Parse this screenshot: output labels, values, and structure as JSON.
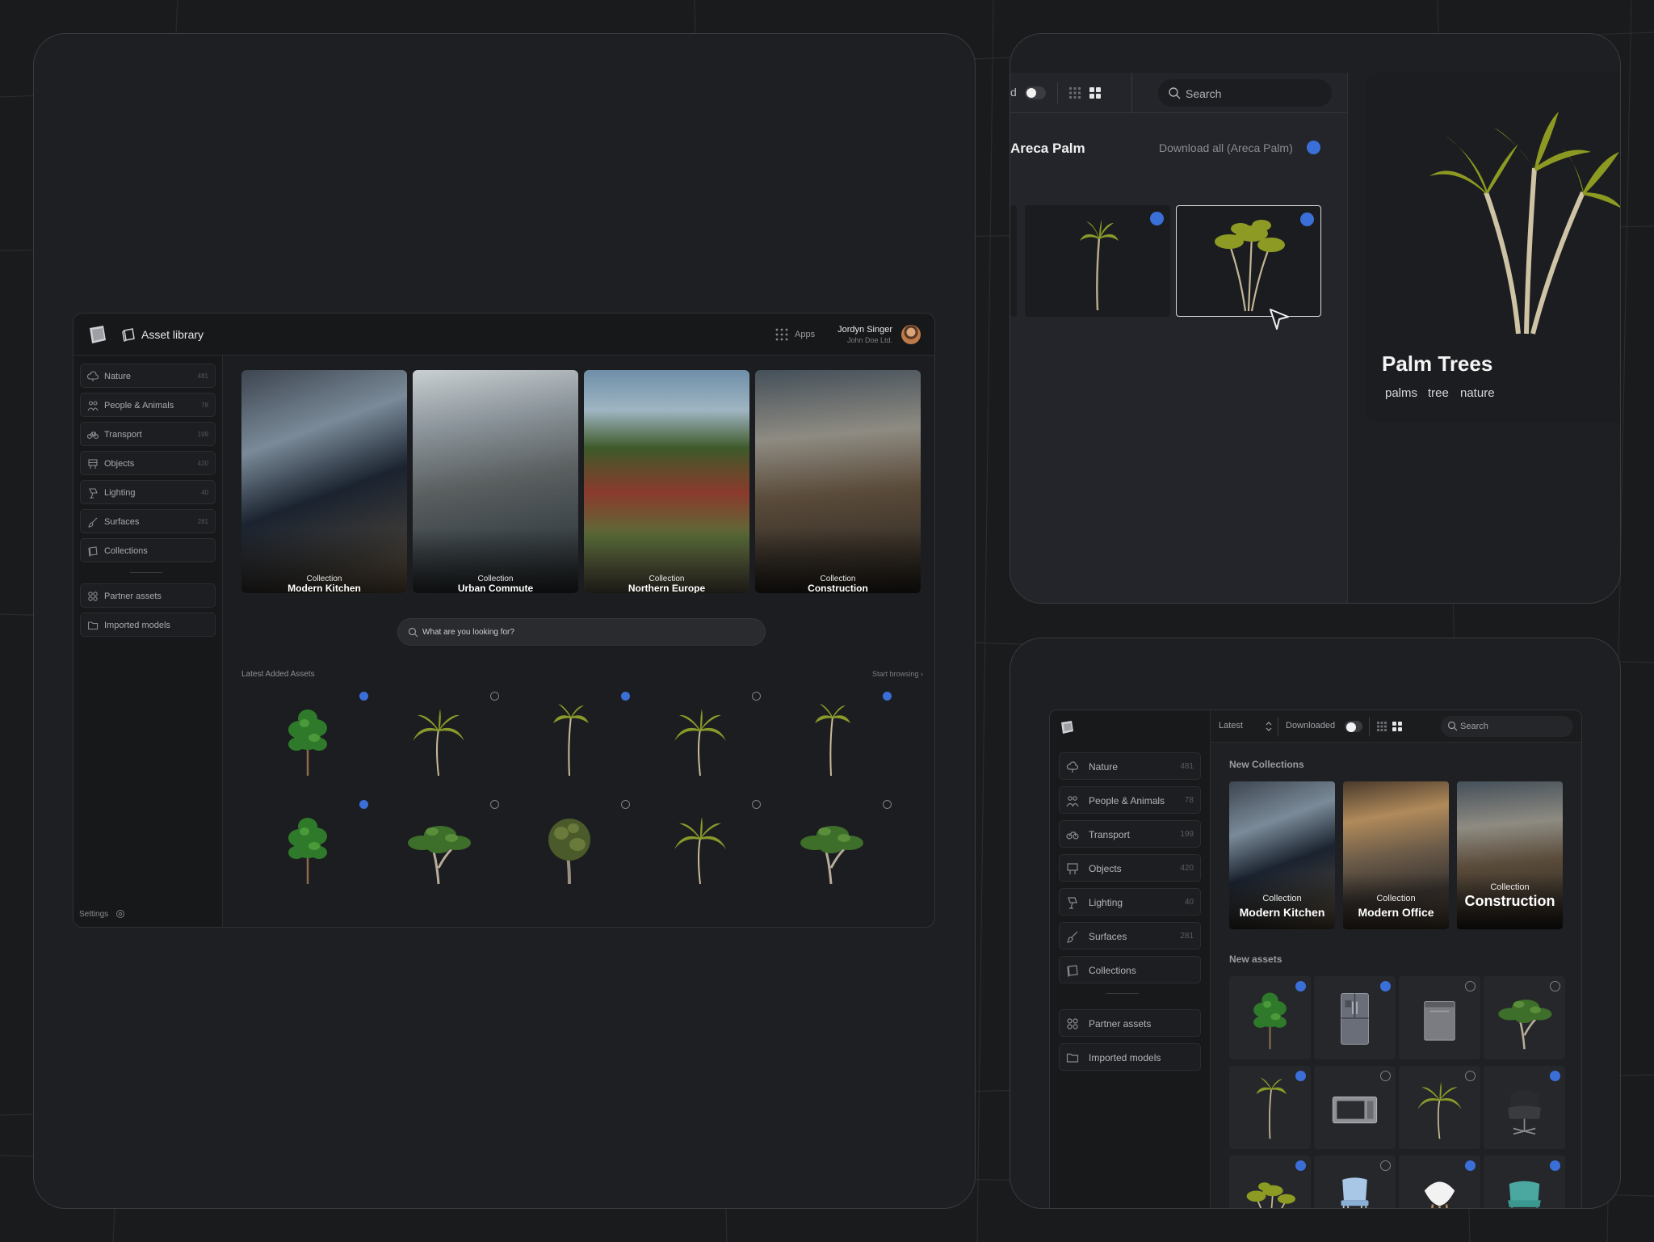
{
  "main_app": {
    "title": "Asset library",
    "apps_label": "Apps",
    "user": {
      "name": "Jordyn Singer",
      "org": "John Doe Ltd."
    },
    "sidebar": [
      {
        "label": "Nature",
        "count": "481",
        "icon": "cloud-icon"
      },
      {
        "label": "People & Animals",
        "count": "78",
        "icon": "people-icon"
      },
      {
        "label": "Transport",
        "count": "199",
        "icon": "bicycle-icon"
      },
      {
        "label": "Objects",
        "count": "420",
        "icon": "object-icon"
      },
      {
        "label": "Lighting",
        "count": "40",
        "icon": "lamp-icon"
      },
      {
        "label": "Surfaces",
        "count": "281",
        "icon": "brush-icon"
      },
      {
        "label": "Collections",
        "count": "",
        "icon": "collection-icon"
      }
    ],
    "sidebar_extra": [
      {
        "label": "Partner assets",
        "icon": "grid-icon"
      },
      {
        "label": "Imported models",
        "icon": "folder-icon"
      }
    ],
    "settings_label": "Settings",
    "collections": [
      {
        "caption": "Collection",
        "name": "Modern Kitchen"
      },
      {
        "caption": "Collection",
        "name": "Urban Commute"
      },
      {
        "caption": "Collection",
        "name": "Northern Europe"
      },
      {
        "caption": "Collection",
        "name": "Construction"
      }
    ],
    "search_placeholder": "What are you looking for?",
    "latest_title": "Latest Added Assets",
    "start_browsing": "Start browsing ›",
    "assets": [
      {
        "kind": "tree",
        "status": "download"
      },
      {
        "kind": "palm",
        "status": "downloaded"
      },
      {
        "kind": "palm-tall",
        "status": "download"
      },
      {
        "kind": "palm",
        "status": "downloaded"
      },
      {
        "kind": "palm-tall",
        "status": "download"
      },
      {
        "kind": "tree",
        "status": "download"
      },
      {
        "kind": "tree-wide",
        "status": "downloaded"
      },
      {
        "kind": "tree-round",
        "status": "downloaded"
      },
      {
        "kind": "palm",
        "status": "downloaded"
      },
      {
        "kind": "tree-wide",
        "status": "downloaded"
      }
    ]
  },
  "detail_view": {
    "toolbar_fragment": "d",
    "search_placeholder": "Search",
    "title": "Areca Palm",
    "download_all": "Download all (Areca Palm)",
    "preview": {
      "title": "Palm Trees",
      "tags": [
        "palms",
        "tree",
        "nature"
      ]
    }
  },
  "compact_app": {
    "sort_label": "Latest",
    "downloaded_label": "Downloaded",
    "search_placeholder": "Search",
    "sidebar": [
      {
        "label": "Nature",
        "count": "481"
      },
      {
        "label": "People & Animals",
        "count": "78"
      },
      {
        "label": "Transport",
        "count": "199"
      },
      {
        "label": "Objects",
        "count": "420"
      },
      {
        "label": "Lighting",
        "count": "40"
      },
      {
        "label": "Surfaces",
        "count": "281"
      },
      {
        "label": "Collections",
        "count": ""
      }
    ],
    "sidebar_extra": [
      {
        "label": "Partner assets"
      },
      {
        "label": "Imported models"
      }
    ],
    "new_collections_title": "New Collections",
    "collections": [
      {
        "caption": "Collection",
        "name": "Modern Kitchen"
      },
      {
        "caption": "Collection",
        "name": "Modern Office"
      },
      {
        "caption": "Collection",
        "name": "Construction"
      }
    ],
    "new_assets_title": "New assets",
    "assets": [
      {
        "kind": "tree",
        "status": "download"
      },
      {
        "kind": "fridge",
        "status": "download"
      },
      {
        "kind": "dishwasher",
        "status": "downloaded"
      },
      {
        "kind": "tree-wide",
        "status": "downloaded"
      },
      {
        "kind": "palm-tall",
        "status": "download"
      },
      {
        "kind": "microwave",
        "status": "downloaded"
      },
      {
        "kind": "palm",
        "status": "downloaded"
      },
      {
        "kind": "armchair",
        "status": "download"
      },
      {
        "kind": "palm-cluster",
        "status": "download"
      },
      {
        "kind": "chair-blue",
        "status": "downloaded"
      },
      {
        "kind": "chair-white",
        "status": "download"
      },
      {
        "kind": "chair-teal",
        "status": "download"
      }
    ]
  },
  "colors": {
    "accent": "#3b6fd8",
    "background": "#1a1b1d",
    "panel": "#1e1f22"
  }
}
